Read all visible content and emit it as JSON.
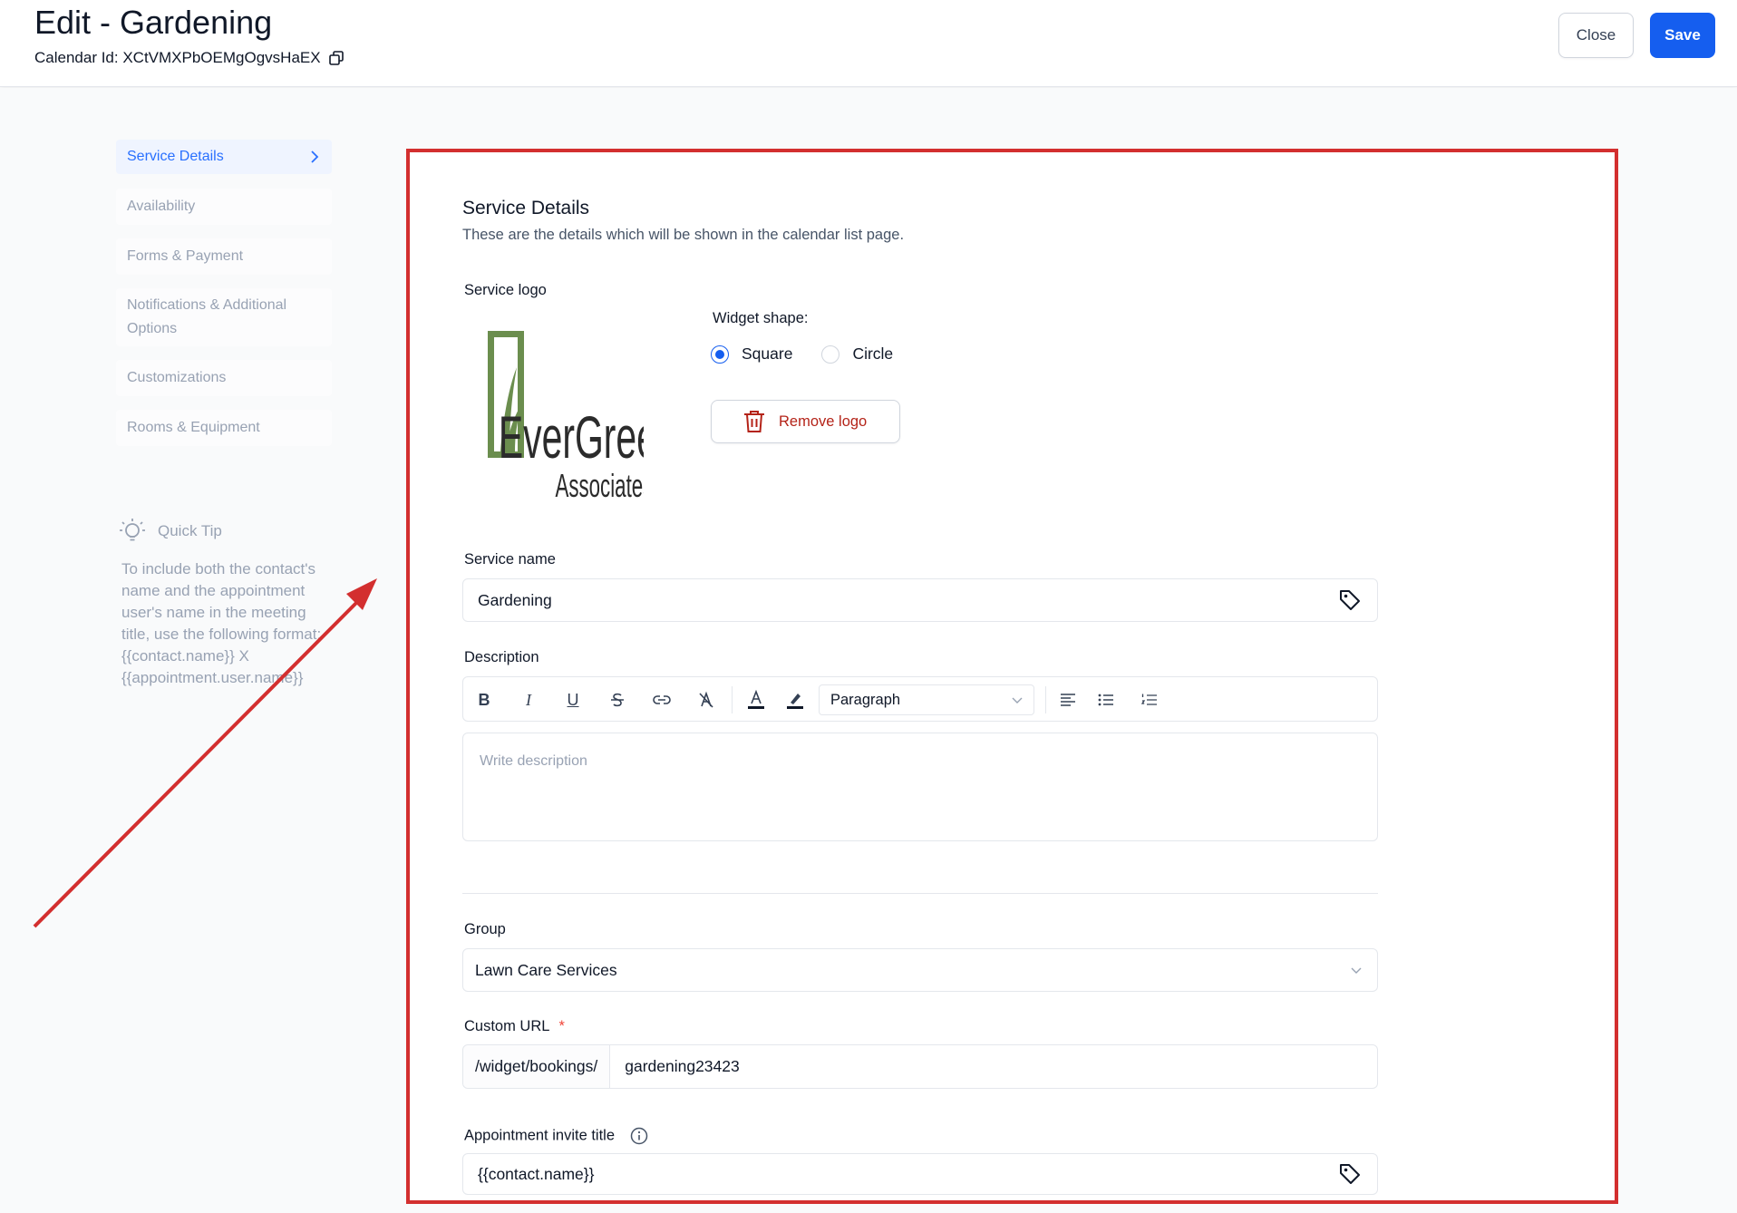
{
  "header": {
    "title": "Edit - Gardening",
    "calendar_id": "Calendar Id: XCtVMXPbOEMgOgvsHaEX",
    "close_label": "Close",
    "save_label": "Save"
  },
  "sidebar": {
    "items": [
      {
        "label": "Service Details",
        "active": true
      },
      {
        "label": "Availability"
      },
      {
        "label": "Forms & Payment"
      },
      {
        "label": "Notifications & Additional Options"
      },
      {
        "label": "Customizations"
      },
      {
        "label": "Rooms & Equipment"
      }
    ],
    "tip": {
      "title": "Quick Tip",
      "text": "To include both the contact's name and the appointment user's name in the meeting title, use the following format: {{contact.name}} X {{appointment.user.name}}"
    }
  },
  "main": {
    "title": "Service Details",
    "subtitle": "These are the details which will be shown in the calendar list page.",
    "logo": {
      "label": "Service logo",
      "brand_line1": "EverGreen",
      "brand_line2": "Associates"
    },
    "widget_shape": {
      "label": "Widget shape:",
      "options": [
        "Square",
        "Circle"
      ],
      "selected": "Square"
    },
    "remove_logo_label": "Remove logo",
    "service_name": {
      "label": "Service name",
      "value": "Gardening"
    },
    "description": {
      "label": "Description",
      "placeholder": "Write description",
      "toolbar": {
        "bold": "B",
        "italic": "I",
        "underline": "U",
        "paragraph_select": "Paragraph"
      }
    },
    "group": {
      "label": "Group",
      "value": "Lawn Care Services"
    },
    "custom_url": {
      "label": "Custom URL",
      "required": "*",
      "prefix": "/widget/bookings/",
      "value": "gardening23423"
    },
    "invite_title": {
      "label": "Appointment invite title",
      "value": "{{contact.name}}"
    }
  },
  "colors": {
    "accent": "#155eef",
    "annotation": "#d32f2f",
    "danger": "#b42318",
    "logo_green": "#6b8e4e"
  }
}
